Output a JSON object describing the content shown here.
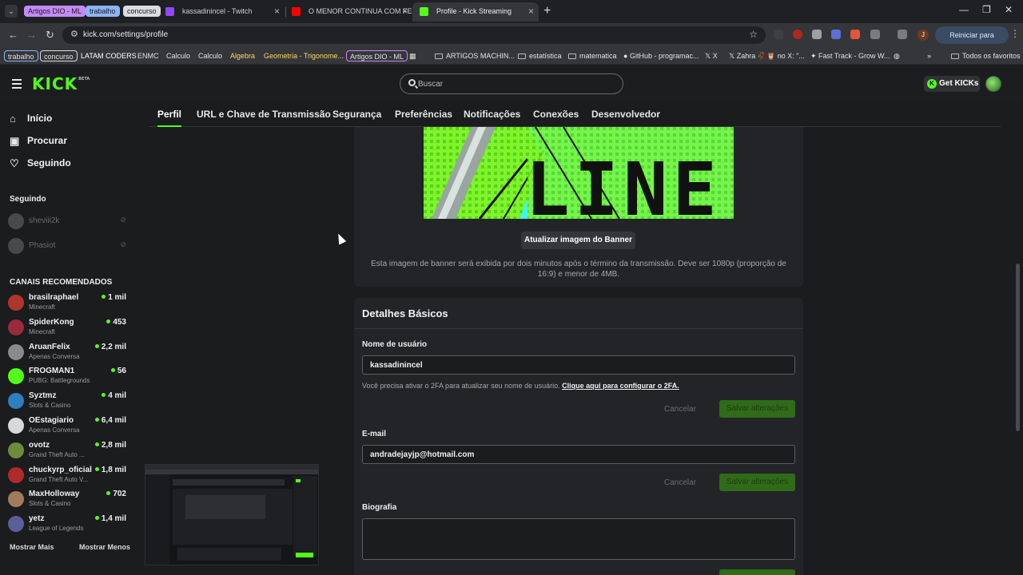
{
  "browser": {
    "tab_groups": [
      {
        "label": "Artigos DIO - ML",
        "color": "#c58af9"
      },
      {
        "label": "trabalho",
        "color": "#8ab4f8"
      },
      {
        "label": "concurso",
        "color": "#dadce0"
      }
    ],
    "tabs": [
      {
        "title": "kassadinincel - Twitch",
        "favicon_color": "#9146ff"
      },
      {
        "title": "O MENOR CONTINUA COM FE",
        "favicon_color": "#ff0000"
      },
      {
        "title": "Profile - Kick Streaming",
        "favicon_color": "#53fc18"
      }
    ],
    "url": "kick.com/settings/profile",
    "update_button": "Reiniciar para atualizar",
    "profile_initial": "J",
    "bookmarks": [
      "trabalho",
      "concurso",
      "LATAM CODERS",
      "ENMC",
      "Calculo",
      "Calculo",
      "Algebra",
      "Geometria - Trigonome...",
      "Artigos DIO - ML",
      "ARTIGOS MACHIN...",
      "estatística",
      "matematica",
      "GitHub - programac...",
      "X",
      "Zahra 🥀🦉 no X: \"...",
      "Fast Track - Grow W...",
      "Todos os favoritos"
    ]
  },
  "header": {
    "logo": "KICK",
    "logo_badge": "BETA",
    "search_placeholder": "Buscar",
    "get_kicks": "Get KICKs"
  },
  "sidebar": {
    "nav": [
      {
        "label": "Início",
        "icon": "home-icon"
      },
      {
        "label": "Procurar",
        "icon": "browse-icon"
      },
      {
        "label": "Seguindo",
        "icon": "heart-icon"
      }
    ],
    "following_title": "Seguindo",
    "following": [
      {
        "name": "sheviii2k"
      },
      {
        "name": "Phasiot"
      }
    ],
    "recommended_title": "CANAIS RECOMENDADOS",
    "recommended": [
      {
        "name": "brasilraphael",
        "category": "Minecraft",
        "viewers": "1 mil",
        "color": "#b0352b"
      },
      {
        "name": "SpiderKong",
        "category": "Minecraft",
        "viewers": "453",
        "color": "#9b2a3a"
      },
      {
        "name": "AruanFelix",
        "category": "Apenas Conversa",
        "viewers": "2,2 mil",
        "color": "#8a8a8a"
      },
      {
        "name": "FROGMAN1",
        "category": "PUBG: Battlegrounds",
        "viewers": "56",
        "color": "#53fc18"
      },
      {
        "name": "Syztmz",
        "category": "Slots & Casino",
        "viewers": "4 mil",
        "color": "#2f7fbf"
      },
      {
        "name": "OEstagiario",
        "category": "Apenas Conversa",
        "viewers": "6,4 mil",
        "color": "#d9d9d9"
      },
      {
        "name": "ovotz",
        "category": "Grand Theft Auto ...",
        "viewers": "2,8 mil",
        "color": "#6e8b3d"
      },
      {
        "name": "chuckyrp_oficial",
        "category": "Grand Theft Auto V...",
        "viewers": "1,8 mil",
        "color": "#b02a2a"
      },
      {
        "name": "MaxHolloway",
        "category": "Slots & Casino",
        "viewers": "702",
        "color": "#a37a5b"
      },
      {
        "name": "yetz",
        "category": "League of Legends",
        "viewers": "1,4 mil",
        "color": "#5a5f9a"
      }
    ],
    "show_more": "Mostrar Mais",
    "show_less": "Mostrar Menos"
  },
  "settings_tabs": [
    "Perfil",
    "URL e Chave de Transmissão",
    "Segurança",
    "Preferências",
    "Notificações",
    "Conexões",
    "Desenvolvedor"
  ],
  "banner": {
    "image_text": "LINE",
    "update_button": "Atualizar imagem do Banner",
    "help_text": "Esta imagem de banner será exibida por dois minutos após o término da transmissão. Deve ser 1080p (proporção de 16:9) e menor de 4MB."
  },
  "details": {
    "title": "Detalhes Básicos",
    "username_label": "Nome de usuário",
    "username_value": "kassadinincel",
    "twofa_note": "Você precisa ativar o 2FA para atualizar seu nome de usuário.",
    "twofa_link": "Clique aqui para configurar o 2FA.",
    "cancel": "Cancelar",
    "save": "Salvar alterações",
    "email_label": "E-mail",
    "email_value": "andradejayjp@hotmail.com",
    "bio_label": "Biografia"
  }
}
